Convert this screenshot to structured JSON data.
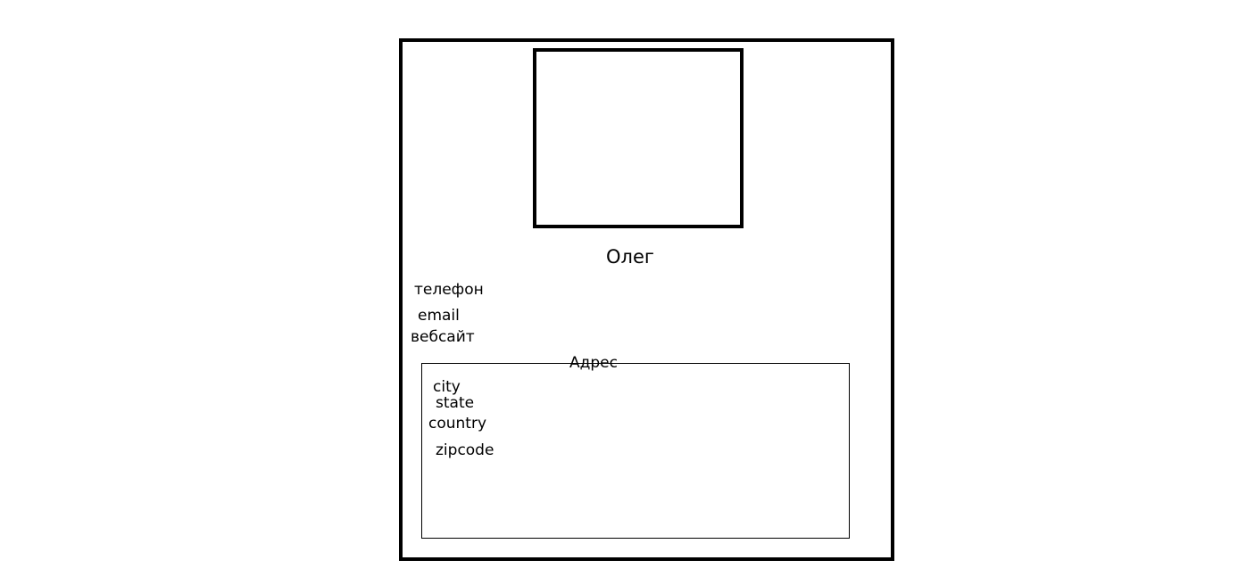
{
  "profile": {
    "name": "Олег",
    "contacts": {
      "phone": "телефон",
      "email": "email",
      "website": "вебсайт"
    },
    "address": {
      "title": "Адрес",
      "city": "city",
      "state": "state",
      "country": "country",
      "zipcode": "zipcode"
    }
  },
  "colors": {
    "stroke": "#000000",
    "background": "#ffffff"
  }
}
